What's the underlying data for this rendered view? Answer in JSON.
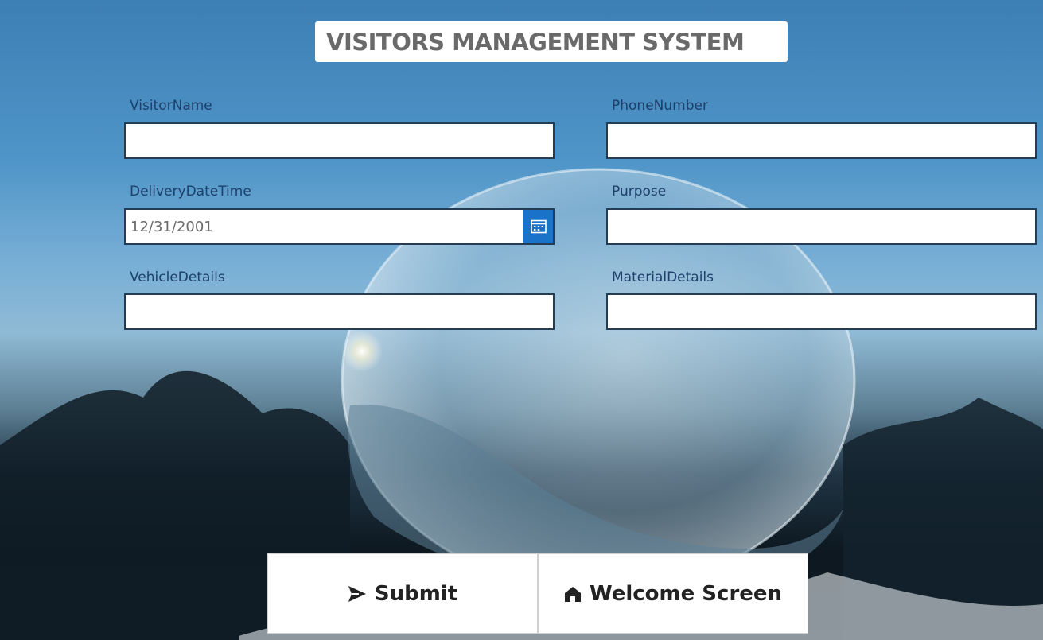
{
  "title": "VISITORS MANAGEMENT SYSTEM",
  "form": {
    "visitor_name": {
      "label": "VisitorName",
      "value": ""
    },
    "phone_number": {
      "label": "PhoneNumber",
      "value": ""
    },
    "delivery_date_time": {
      "label": "DeliveryDateTime",
      "value": "12/31/2001"
    },
    "purpose": {
      "label": "Purpose",
      "value": ""
    },
    "vehicle_details": {
      "label": "VehicleDetails",
      "value": ""
    },
    "material_details": {
      "label": "MaterialDetails",
      "value": ""
    }
  },
  "buttons": {
    "submit": {
      "label": "Submit",
      "icon": "send-arrow-icon"
    },
    "welcome": {
      "label": "Welcome Screen",
      "icon": "home-icon"
    }
  },
  "colors": {
    "label": "#1d3f6a",
    "input_border": "#263c52",
    "calendar_button": "#1a73c8",
    "title_text": "#6a6a6a"
  }
}
